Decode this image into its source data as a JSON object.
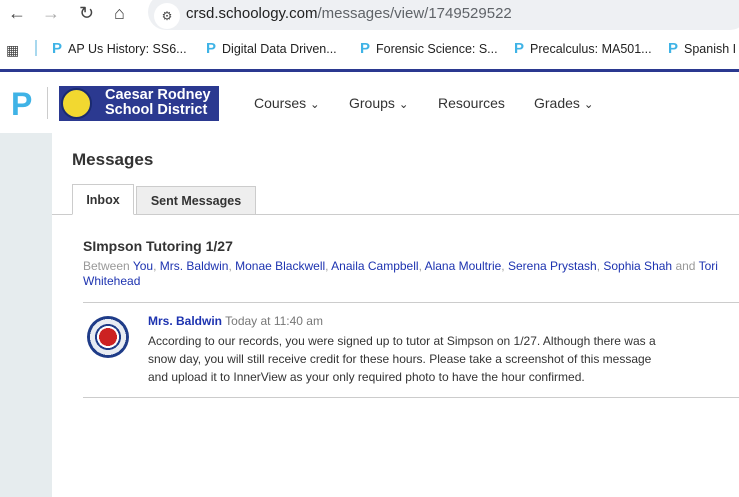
{
  "browser": {
    "url_host": "crsd.schoology.com",
    "url_path": "/messages/view/1749529522",
    "bookmarks": [
      "AP Us History: SS6...",
      "Digital Data Driven...",
      "Forensic Science: S...",
      "Precalculus: MA501...",
      "Spanish I"
    ]
  },
  "header": {
    "district_line1": "Caesar Rodney",
    "district_line2": "School District",
    "menu": [
      "Courses",
      "Groups",
      "Resources",
      "Grades"
    ]
  },
  "page": {
    "title": "Messages",
    "tabs": [
      "Inbox",
      "Sent Messages"
    ]
  },
  "thread": {
    "subject": "SImpson Tutoring 1/27",
    "between_label": "Between",
    "and_label": "and",
    "participants": [
      "You",
      "Mrs. Baldwin",
      "Monae Blackwell",
      "Anaila Campbell",
      "Alana Moultrie",
      "Serena Prystash",
      "Sophia Shah",
      "Tori Whitehead"
    ]
  },
  "message": {
    "author": "Mrs. Baldwin",
    "time": "Today at 11:40 am",
    "body": "According to our records, you were signed up to tutor at Simpson on 1/27. Although there was a snow day, you will still receive credit for these hours. Please take a screenshot of this message and upload it to InnerView as your only required photo to have the hour confirmed."
  }
}
